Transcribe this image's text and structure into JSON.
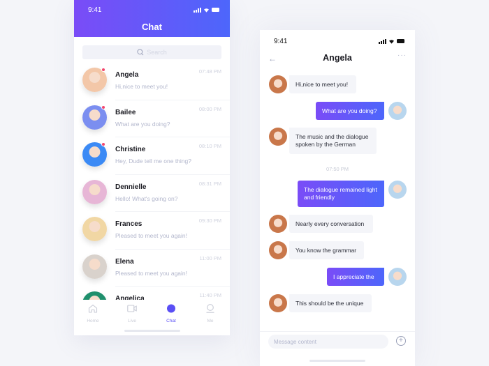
{
  "left_screen": {
    "status_time": "9:41",
    "title": "Chat",
    "search_placeholder": "Search",
    "chats": [
      {
        "name": "Angela",
        "message": "Hi,nice to meet you!",
        "time": "07:48 PM",
        "unread": true,
        "avatar_color": "#f3c7a8"
      },
      {
        "name": "Bailee",
        "message": "What are you doing?",
        "time": "08:00 PM",
        "unread": true,
        "avatar_color": "#7b8ef0"
      },
      {
        "name": "Christine",
        "message": "Hey, Dude tell me one thing?",
        "time": "08:10 PM",
        "unread": true,
        "avatar_color": "#3b8af5"
      },
      {
        "name": "Dennielle",
        "message": "Hello!  What's going on?",
        "time": "08:31 PM",
        "unread": false,
        "avatar_color": "#e7b6d6"
      },
      {
        "name": "Frances",
        "message": "Pleased to meet you again!",
        "time": "09:30 PM",
        "unread": false,
        "avatar_color": "#f1d7a4"
      },
      {
        "name": "Elena",
        "message": "Pleased to meet you again!",
        "time": "11:00 PM",
        "unread": false,
        "avatar_color": "#d9d2cc"
      },
      {
        "name": "Angelica",
        "message": "",
        "time": "11:40 PM",
        "unread": false,
        "avatar_color": "#1f8f6c"
      }
    ],
    "tabs": [
      {
        "label": "Home",
        "icon": "home-icon",
        "active": false
      },
      {
        "label": "Live",
        "icon": "video-icon",
        "active": false
      },
      {
        "label": "Chat",
        "icon": "chat-icon",
        "active": true
      },
      {
        "label": "Me",
        "icon": "profile-icon",
        "active": false
      }
    ]
  },
  "right_screen": {
    "status_time": "9:41",
    "contact_name": "Angela",
    "back_icon": "arrow-left-icon",
    "more_icon": "more-icon",
    "messages": [
      {
        "dir": "in",
        "text": "Hi,nice to meet you!"
      },
      {
        "dir": "out",
        "text": "What are you doing?"
      },
      {
        "dir": "in",
        "text": "The music and the dialogue spoken by the German"
      },
      {
        "dir": "time",
        "text": "07:50 PM"
      },
      {
        "dir": "out",
        "text": "The dialogue remained light and friendly"
      },
      {
        "dir": "in",
        "text": "Nearly every conversation"
      },
      {
        "dir": "in",
        "text": "You know the grammar"
      },
      {
        "dir": "out",
        "text": "I appreciate the"
      },
      {
        "dir": "in",
        "text": "This should be the unique"
      }
    ],
    "composer_placeholder": "Message content",
    "add_icon": "plus-circle-icon"
  },
  "colors": {
    "accent_start": "#7a4cf7",
    "accent_end": "#4d66fb",
    "unread_dot": "#f2456e",
    "active_tab": "#5a4ff5"
  }
}
